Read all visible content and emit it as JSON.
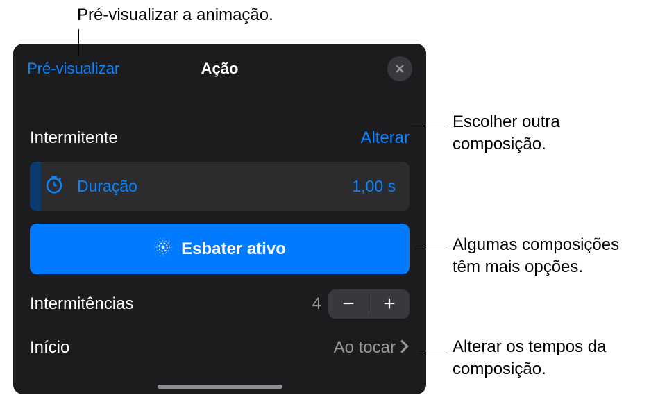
{
  "header": {
    "preview_label": "Pré-visualizar",
    "title": "Ação"
  },
  "effect": {
    "name": "Intermitente",
    "change_label": "Alterar"
  },
  "duration": {
    "label": "Duração",
    "value": "1,00 s"
  },
  "blur": {
    "label": "Esbater ativo"
  },
  "repeats": {
    "label": "Intermitências",
    "value": "4"
  },
  "start": {
    "label": "Início",
    "value": "Ao tocar"
  },
  "callouts": {
    "c1": "Pré-visualizar a animação.",
    "c2_line1": "Escolher outra",
    "c2_line2": "composição.",
    "c3_line1": "Algumas composições",
    "c3_line2": "têm mais opções.",
    "c4_line1": "Alterar os tempos da",
    "c4_line2": "composição."
  }
}
